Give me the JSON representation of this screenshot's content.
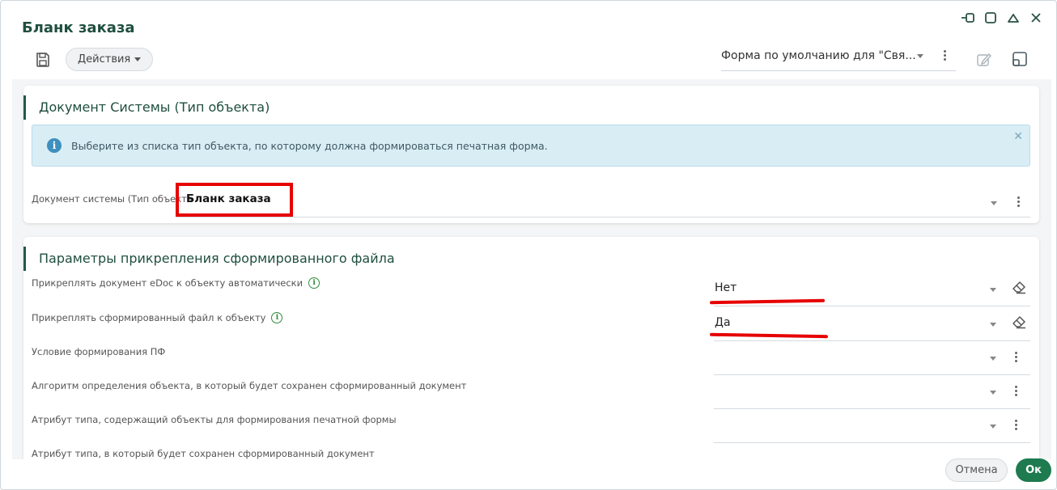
{
  "window": {
    "title": "Бланк заказа"
  },
  "toolbar": {
    "save_icon": "save-icon",
    "actions_label": "Действия",
    "form_select_value": "Форма по умолчанию для \"Свя...",
    "edit_icon": "edit-icon",
    "layout_icon": "layout-icon"
  },
  "card_system": {
    "title": "Документ Системы (Тип объекта)",
    "info_text": "Выберите из списка тип объекта, по которому должна формироваться печатная форма.",
    "field_label": "Документ системы (Тип объекта",
    "field_value": "Бланк заказа"
  },
  "card_params": {
    "title": "Параметры прикрепления сформированного файла",
    "rows": [
      {
        "label": "Прикреплять документ eDoc к объекту автоматически",
        "value": "Нет"
      },
      {
        "label": "Прикреплять сформированный файл к объекту",
        "value": "Да"
      },
      {
        "label": "Условие формирования ПФ",
        "value": ""
      },
      {
        "label": "Алгоритм определения объекта, в который будет сохранен сформированный документ",
        "value": ""
      },
      {
        "label": "Атрибут типа, содержащий объекты для формирования печатной формы",
        "value": ""
      },
      {
        "label": "Атрибут типа, в который будет сохранен сформированный документ",
        "value": ""
      }
    ]
  },
  "footer": {
    "cancel_label": "Отмена",
    "ok_label": "Ок"
  },
  "colors": {
    "accent_green": "#1e7a4f",
    "title_green": "#1f4f3e",
    "highlight_red": "#e60000",
    "info_bg": "#d9edf5"
  }
}
